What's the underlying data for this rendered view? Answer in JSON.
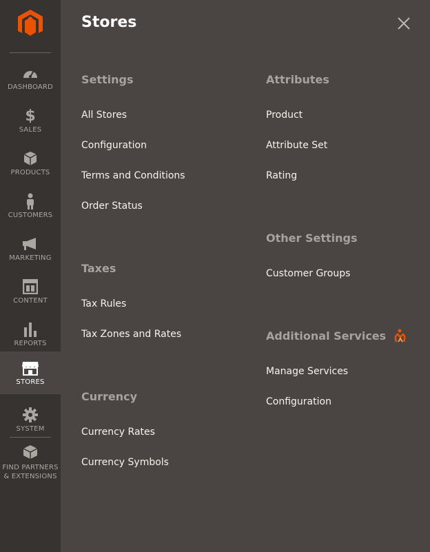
{
  "sidebar": {
    "logo": "magento-logo-icon",
    "items": [
      {
        "label": "Dashboard",
        "icon": "dashboard-icon"
      },
      {
        "label": "Sales",
        "icon": "dollar-icon"
      },
      {
        "label": "Products",
        "icon": "box-icon"
      },
      {
        "label": "Customers",
        "icon": "person-icon"
      },
      {
        "label": "Marketing",
        "icon": "megaphone-icon"
      },
      {
        "label": "Content",
        "icon": "layout-icon"
      },
      {
        "label": "Reports",
        "icon": "bar-chart-icon"
      },
      {
        "label": "Stores",
        "icon": "storefront-icon"
      },
      {
        "label": "System",
        "icon": "gear-icon"
      },
      {
        "label": "Find Partners & Extensions",
        "icon": "partners-box-icon"
      }
    ],
    "active": "Stores"
  },
  "panel": {
    "title": "Stores",
    "close_icon": "close-icon",
    "sections": {
      "settings": {
        "heading": "Settings",
        "links": [
          "All Stores",
          "Configuration",
          "Terms and Conditions",
          "Order Status"
        ]
      },
      "taxes": {
        "heading": "Taxes",
        "links": [
          "Tax Rules",
          "Tax Zones and Rates"
        ]
      },
      "currency": {
        "heading": "Currency",
        "links": [
          "Currency Rates",
          "Currency Symbols"
        ]
      },
      "attributes": {
        "heading": "Attributes",
        "links": [
          "Product",
          "Attribute Set",
          "Rating"
        ]
      },
      "other_settings": {
        "heading": "Other Settings",
        "links": [
          "Customer Groups"
        ]
      },
      "additional_services": {
        "heading": "Additional Services",
        "badge_icon": "services-badge-icon",
        "links": [
          "Manage Services",
          "Configuration"
        ]
      }
    }
  },
  "colors": {
    "sidebar_bg": "#373330",
    "panel_bg": "#4a4542",
    "heading": "#a8a29e",
    "link": "#f7f3eb",
    "accent": "#eb5202"
  }
}
